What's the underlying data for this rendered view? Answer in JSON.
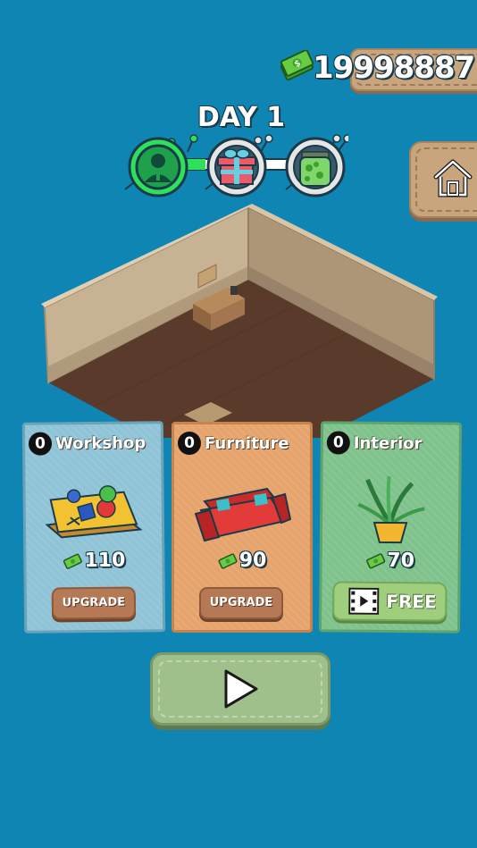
{
  "hud": {
    "money": "19998887",
    "money_icon": "cash-stack-icon",
    "home_icon": "home-icon"
  },
  "day": {
    "title": "DAY 1",
    "stages": [
      {
        "icon": "worker-icon",
        "state": "active"
      },
      {
        "icon": "gift-box-icon",
        "state": "locked"
      },
      {
        "icon": "money-jar-icon",
        "state": "locked"
      }
    ]
  },
  "upgrades": [
    {
      "level": "0",
      "title": "Workshop",
      "price": "110",
      "action": "UPGRADE",
      "art": "workbench-icon",
      "color": "#8fc3d6"
    },
    {
      "level": "0",
      "title": "Furniture",
      "price": "90",
      "action": "UPGRADE",
      "art": "sofa-icon",
      "color": "#e6a46c"
    },
    {
      "level": "0",
      "title": "Interior",
      "price": "70",
      "action": "FREE",
      "art": "plant-icon",
      "color": "#7fc28b"
    }
  ],
  "play": {
    "icon": "play-icon"
  },
  "colors": {
    "background": "#0f85b4",
    "progress": "#2fe05a"
  }
}
